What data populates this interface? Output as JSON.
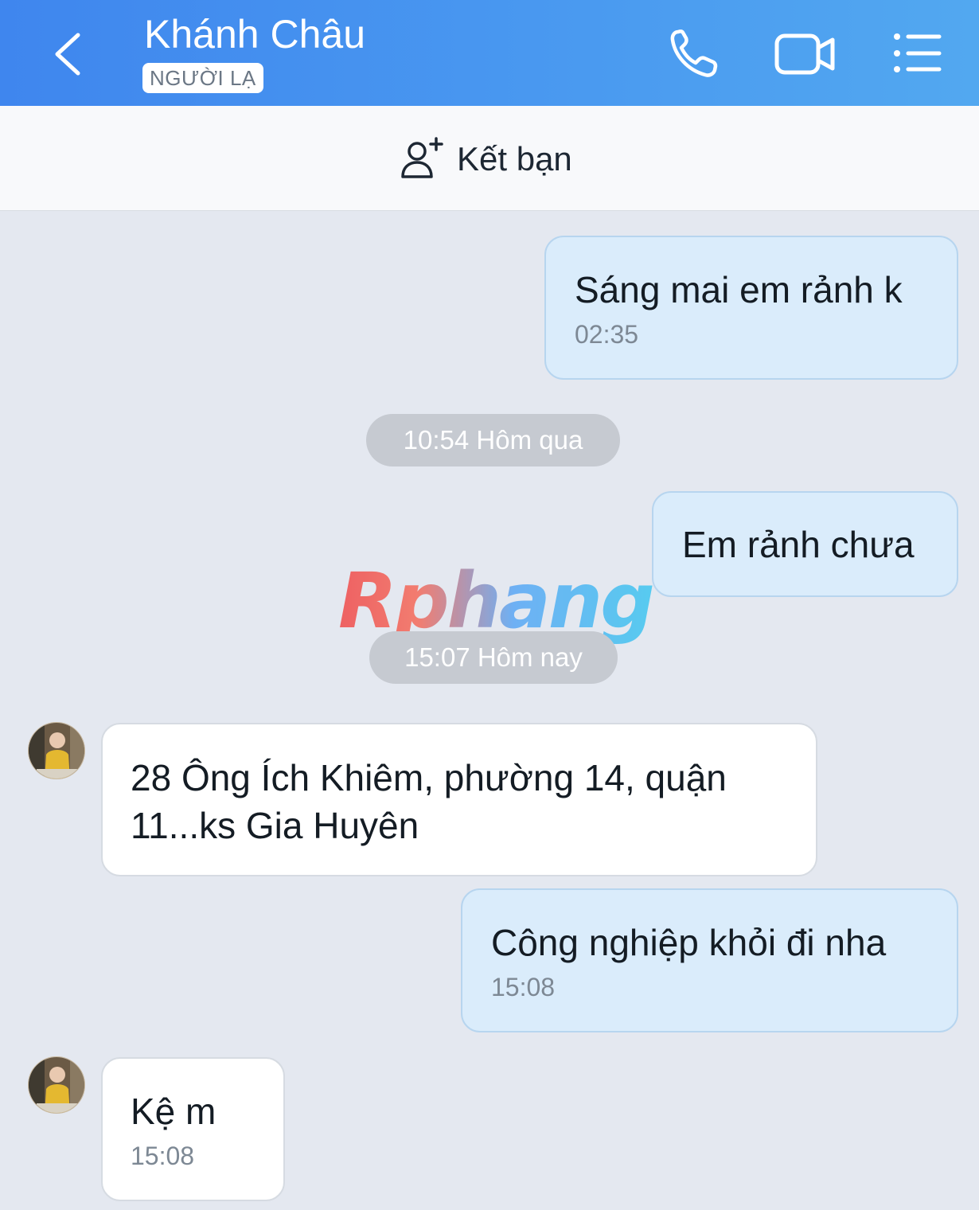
{
  "header": {
    "title": "Khánh Châu",
    "badge": "NGƯỜI LẠ",
    "icons": [
      "back-icon",
      "phone-icon",
      "video-icon",
      "menu-icon"
    ]
  },
  "add_friend": {
    "label": "Kết bạn",
    "icon": "add-person-icon"
  },
  "messages": [
    {
      "direction": "out",
      "text": "Sáng mai em rảnh k",
      "time": "02:35"
    },
    {
      "type": "divider",
      "text": "10:54 Hôm qua"
    },
    {
      "direction": "out",
      "text": "Em rảnh chưa"
    },
    {
      "type": "divider",
      "text": "15:07 Hôm nay"
    },
    {
      "direction": "in",
      "text_lines": [
        "28 Ông Ích Khiêm, phường 14, quận",
        "11...ks Gia Huyên"
      ]
    },
    {
      "direction": "out",
      "text": "Công nghiệp khỏi đi nha",
      "time": "15:08"
    },
    {
      "direction": "in",
      "text": "Kệ m",
      "time": "15:08"
    }
  ],
  "watermark": "Rphang",
  "colors": {
    "header": "#3f86ee",
    "outgoing_bubble": "#daecfb",
    "incoming_bubble": "#ffffff",
    "background": "#e4e8f0"
  }
}
